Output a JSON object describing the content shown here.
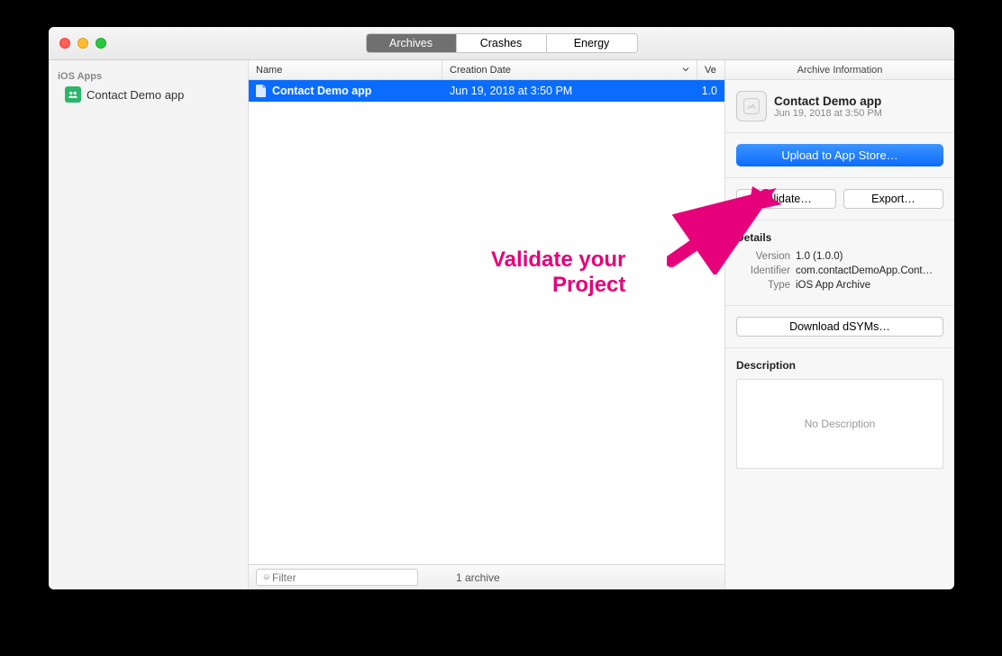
{
  "tabs": {
    "archives": "Archives",
    "crashes": "Crashes",
    "energy": "Energy"
  },
  "sidebar": {
    "header": "iOS Apps",
    "items": [
      {
        "label": "Contact Demo app"
      }
    ]
  },
  "table": {
    "headers": {
      "name": "Name",
      "date": "Creation Date",
      "version": "Ve"
    },
    "rows": [
      {
        "name": "Contact Demo app",
        "date": "Jun 19, 2018 at 3:50 PM",
        "version": "1.0"
      }
    ]
  },
  "footer": {
    "filter_placeholder": "Filter",
    "status": "1 archive"
  },
  "inspector": {
    "header": "Archive Information",
    "app_name": "Contact Demo app",
    "app_date": "Jun 19, 2018 at 3:50 PM",
    "upload_label": "Upload to App Store…",
    "validate_label": "Validate…",
    "export_label": "Export…",
    "details_title": "Details",
    "version_label": "Version",
    "version_val": "1.0 (1.0.0)",
    "identifier_label": "Identifier",
    "identifier_val": "com.contactDemoApp.Cont…",
    "type_label": "Type",
    "type_val": "iOS App Archive",
    "download_label": "Download dSYMs…",
    "description_title": "Description",
    "no_desc": "No Description"
  },
  "annotation": {
    "line1": "Validate your",
    "line2": "Project"
  }
}
